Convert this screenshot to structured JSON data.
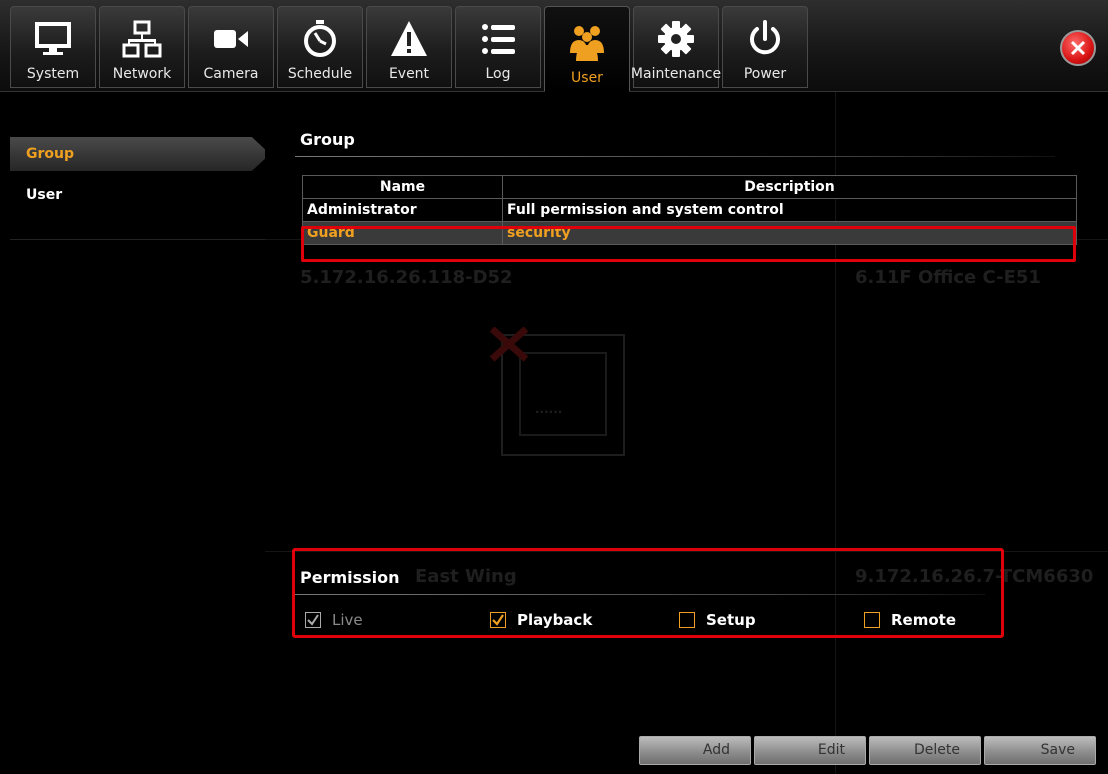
{
  "toolbar": {
    "tabs": [
      {
        "label": "System",
        "icon": "monitor-icon",
        "active": false
      },
      {
        "label": "Network",
        "icon": "network-icon",
        "active": false
      },
      {
        "label": "Camera",
        "icon": "camera-icon",
        "active": false
      },
      {
        "label": "Schedule",
        "icon": "stopwatch-icon",
        "active": false
      },
      {
        "label": "Event",
        "icon": "warning-icon",
        "active": false
      },
      {
        "label": "Log",
        "icon": "list-icon",
        "active": false
      },
      {
        "label": "User",
        "icon": "users-icon",
        "active": true
      },
      {
        "label": "Maintenance",
        "icon": "gear-icon",
        "active": false
      },
      {
        "label": "Power",
        "icon": "power-icon",
        "active": false
      }
    ],
    "close_icon": "close-icon"
  },
  "sidebar": {
    "items": [
      {
        "label": "Group",
        "active": true
      },
      {
        "label": "User",
        "active": false
      }
    ]
  },
  "background_ghost": {
    "cam_left": "5.172.16.26.118-D52",
    "cam_right": "6.11F Office C-E51",
    "cam_east": "East Wing",
    "cam_right2": "9.172.16.26.7-TCM6630",
    "dots": "......"
  },
  "group_section": {
    "title": "Group",
    "columns": [
      "Name",
      "Description"
    ],
    "rows": [
      {
        "name": "Administrator",
        "description": "Full permission and system control",
        "selected": false
      },
      {
        "name": "Guard",
        "description": "security",
        "selected": true
      }
    ]
  },
  "permission_section": {
    "title": "Permission",
    "items": [
      {
        "label": "Live",
        "checked": true,
        "enabled": false
      },
      {
        "label": "Playback",
        "checked": true,
        "enabled": true
      },
      {
        "label": "Setup",
        "checked": false,
        "enabled": true
      },
      {
        "label": "Remote",
        "checked": false,
        "enabled": true
      }
    ]
  },
  "buttons": {
    "add": "Add",
    "edit": "Edit",
    "delete": "Delete",
    "save": "Save"
  },
  "colors": {
    "accent": "#f0a020",
    "highlight_border": "#e0000a",
    "disabled_text": "#8a8a8a"
  }
}
